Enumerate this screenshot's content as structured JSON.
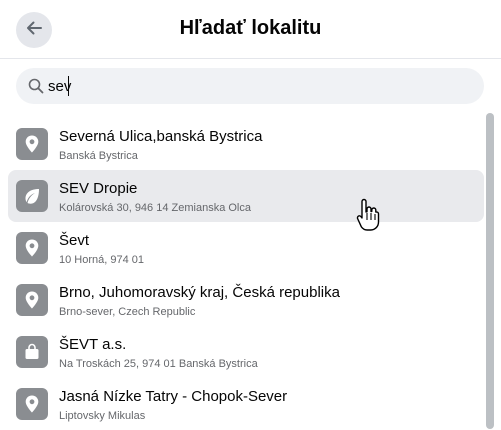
{
  "header": {
    "title": "Hľadať lokalitu",
    "back_icon": "arrow-left-icon"
  },
  "search": {
    "value": "sev",
    "icon": "search-icon"
  },
  "results": [
    {
      "name": "Severná Ulica,banská Bystrica",
      "sub": "Banská Bystrica",
      "icon": "map-pin-icon"
    },
    {
      "name": "SEV Dropie",
      "sub": "Kolárovská 30, 946 14 Zemianska Olca",
      "icon": "leaf-icon"
    },
    {
      "name": "Ševt",
      "sub": "10 Horná, 974 01",
      "icon": "map-pin-icon"
    },
    {
      "name": "Brno, Juhomoravský kraj, Česká republika",
      "sub": "Brno-sever, Czech Republic",
      "icon": "map-pin-icon"
    },
    {
      "name": "ŠEVT a.s.",
      "sub": "Na Troskách 25, 974 01 Banská Bystrica",
      "icon": "shopping-bag-icon"
    },
    {
      "name": "Jasná Nízke Tatry - Chopok-Sever",
      "sub": "Liptovsky Mikulas",
      "icon": "map-pin-icon"
    }
  ],
  "colors": {
    "icon_bg": "#8a8d91",
    "hover_bg": "#e9eaed",
    "search_bg": "#f0f2f5"
  }
}
